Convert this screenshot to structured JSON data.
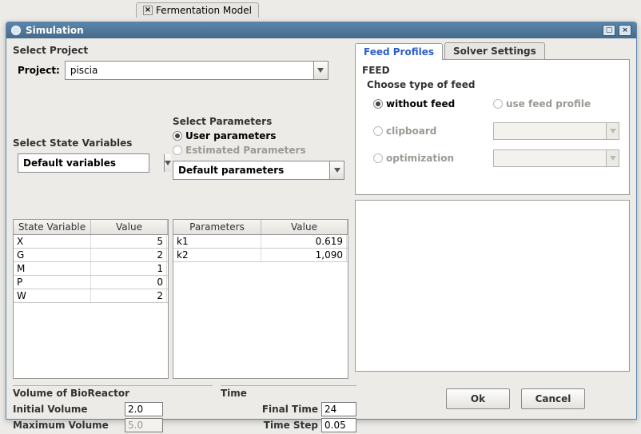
{
  "background_tab": "Fermentation Model",
  "dialog": {
    "title": "Simulation",
    "select_project_title": "Select Project",
    "project_label": "Project:",
    "project_value": "piscia",
    "select_state_vars_title": "Select State Variables",
    "state_vars_combo": "Default variables",
    "select_params_title": "Select Parameters",
    "user_params_label": "User parameters",
    "est_params_label": "Estimated Parameters",
    "params_combo": "Default parameters",
    "state_table": {
      "col1": "State Variable",
      "col2": "Value",
      "rows": [
        {
          "n": "X",
          "v": "5"
        },
        {
          "n": "G",
          "v": "2"
        },
        {
          "n": "M",
          "v": "1"
        },
        {
          "n": "P",
          "v": "0"
        },
        {
          "n": "W",
          "v": "2"
        }
      ]
    },
    "param_table": {
      "col1": "Parameters",
      "col2": "Value",
      "rows": [
        {
          "n": "k1",
          "v": "0.619"
        },
        {
          "n": "k2",
          "v": "1,090"
        }
      ]
    },
    "vol_title": "Volume of BioReactor",
    "init_vol_label": "Initial Volume",
    "init_vol_value": "2.0",
    "max_vol_label": "Maximum Volume",
    "max_vol_value": "5.0",
    "time_title": "Time",
    "final_time_label": "Final Time",
    "final_time_value": "24",
    "time_step_label": "Time Step",
    "time_step_value": "0.05",
    "tabs": {
      "feed": "Feed Profiles",
      "solver": "Solver Settings"
    },
    "feed_title": "FEED",
    "feed_choose": "Choose type of feed",
    "feed_opts": {
      "without": "without feed",
      "use_profile": "use feed profile",
      "clipboard": "clipboard",
      "optimization": "optimization"
    },
    "ok": "Ok",
    "cancel": "Cancel"
  }
}
